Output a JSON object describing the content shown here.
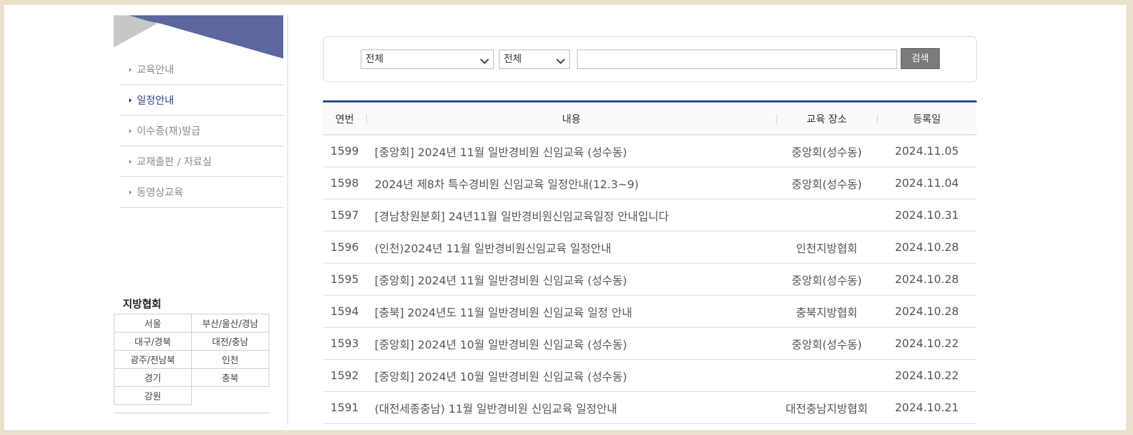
{
  "sidebar": {
    "menu": [
      {
        "label": "교육안내",
        "active": false
      },
      {
        "label": "일정안내",
        "active": true
      },
      {
        "label": "이수증(재)발급",
        "active": false
      },
      {
        "label": "교재출판 / 자료실",
        "active": false
      },
      {
        "label": "동영상교육",
        "active": false
      }
    ],
    "region_title": "지방협회",
    "regions": [
      "서울",
      "부산/울산/경남",
      "대구/경북",
      "대전/충남",
      "광주/전남북",
      "인천",
      "경기",
      "충북",
      "강원"
    ],
    "colors": {
      "banner_blue": "#5b679e",
      "banner_gray": "#c7c7c7",
      "active": "#2c3e86"
    }
  },
  "search": {
    "select1_value": "전체",
    "select2_value": "전체",
    "input_value": "",
    "button_label": "검색"
  },
  "table": {
    "headers": [
      "연번",
      "내용",
      "교육 장소",
      "등록일"
    ],
    "rows": [
      {
        "num": "1599",
        "title": "[중앙회] 2024년 11월 일반경비원 신임교육 (성수동)",
        "place": "중앙회(성수동)",
        "date": "2024.11.05"
      },
      {
        "num": "1598",
        "title": "2024년 제8차 특수경비원 신임교육 일정안내(12.3~9)",
        "place": "중앙회(성수동)",
        "date": "2024.11.04"
      },
      {
        "num": "1597",
        "title": "[경남창원분회] 24년11월 일반경비원신임교육일정 안내입니다",
        "place": "",
        "date": "2024.10.31"
      },
      {
        "num": "1596",
        "title": "(인천)2024년 11월 일반경비원신임교육 일정안내",
        "place": "인천지방협회",
        "date": "2024.10.28"
      },
      {
        "num": "1595",
        "title": "[중앙회] 2024년 11월 일반경비원 신임교육 (성수동)",
        "place": "중앙회(성수동)",
        "date": "2024.10.28"
      },
      {
        "num": "1594",
        "title": "[충북] 2024년도 11월 일반경비원 신임교육 일정 안내",
        "place": "충북지방협회",
        "date": "2024.10.28"
      },
      {
        "num": "1593",
        "title": "[중앙회] 2024년 10월 일반경비원 신임교육 (성수동)",
        "place": "중앙회(성수동)",
        "date": "2024.10.22"
      },
      {
        "num": "1592",
        "title": "[중앙회] 2024년 10월 일반경비원 신임교육 (성수동)",
        "place": "",
        "date": "2024.10.22"
      },
      {
        "num": "1591",
        "title": "(대전세종충남) 11월 일반경비원 신임교육 일정안내",
        "place": "대전충남지방협회",
        "date": "2024.10.21"
      }
    ],
    "accent_color": "#2c4a8a"
  }
}
